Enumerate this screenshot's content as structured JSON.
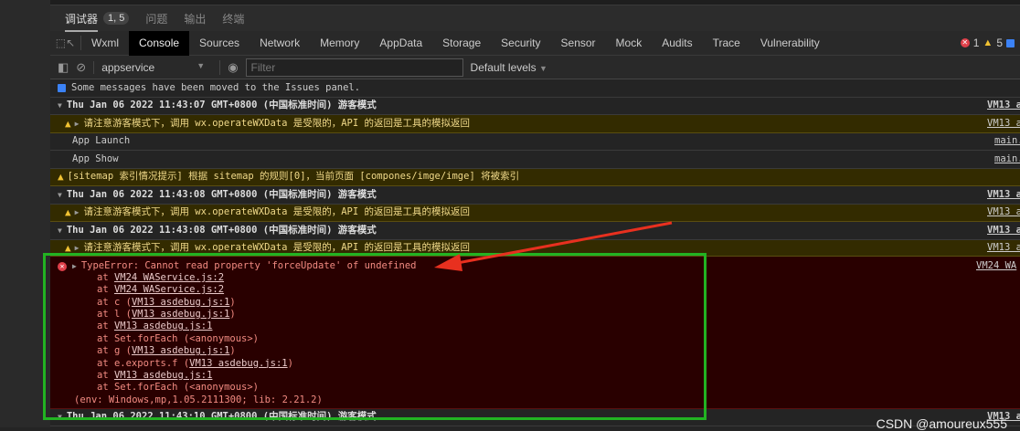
{
  "top_tabs": [
    {
      "label": "调试器",
      "badge": "1, 5"
    },
    {
      "label": "问题"
    },
    {
      "label": "输出"
    },
    {
      "label": "终端"
    }
  ],
  "dev_tabs": [
    "Wxml",
    "Console",
    "Sources",
    "Network",
    "Memory",
    "AppData",
    "Storage",
    "Security",
    "Sensor",
    "Mock",
    "Audits",
    "Trace",
    "Vulnerability"
  ],
  "counts": {
    "errors": "1",
    "warnings": "5"
  },
  "filterbar": {
    "context": "appservice",
    "filter_placeholder": "Filter",
    "levels": "Default levels"
  },
  "messages": {
    "issues": "Some messages have been moved to the Issues panel.",
    "group1": "Thu Jan 06 2022 11:43:07 GMT+0800 (中国标准时间) 游客模式",
    "warn_guest": "请注意游客模式下，调用 wx.operateWXData 是受限的，API 的返回是工具的模拟返回",
    "app_launch": "App Launch",
    "app_show": "App Show",
    "sitemap": "[sitemap 索引情况提示] 根据 sitemap 的规则[0]，当前页面 [compones/imge/imge] 将被索引",
    "group2": "Thu Jan 06 2022 11:43:08 GMT+0800 (中国标准时间) 游客模式",
    "group3": "Thu Jan 06 2022 11:43:08 GMT+0800 (中国标准时间) 游客模式",
    "group4": "Thu Jan 06 2022 11:43:10 GMT+0800 (中国标准时间) 游客模式",
    "src_vm13": "VM13 a",
    "src_main": "main.",
    "src_vm24": "VM24 WA"
  },
  "error": {
    "message": "TypeError: Cannot read property 'forceUpdate' of undefined",
    "stack": [
      {
        "pre": "at ",
        "link": "VM24 WAService.js:2",
        "post": ""
      },
      {
        "pre": "at ",
        "link": "VM24 WAService.js:2",
        "post": ""
      },
      {
        "pre": "at c (",
        "link": "VM13 asdebug.js:1",
        "post": ")"
      },
      {
        "pre": "at l (",
        "link": "VM13 asdebug.js:1",
        "post": ")"
      },
      {
        "pre": "at ",
        "link": "VM13 asdebug.js:1",
        "post": ""
      },
      {
        "pre": "at Set.forEach (<anonymous>)",
        "link": "",
        "post": ""
      },
      {
        "pre": "at g (",
        "link": "VM13 asdebug.js:1",
        "post": ")"
      },
      {
        "pre": "at e.exports.f (",
        "link": "VM13 asdebug.js:1",
        "post": ")"
      },
      {
        "pre": "at ",
        "link": "VM13 asdebug.js:1",
        "post": ""
      },
      {
        "pre": "at Set.forEach (<anonymous>)",
        "link": "",
        "post": ""
      }
    ],
    "env": "(env: Windows,mp,1.05.2111300; lib: 2.21.2)"
  },
  "watermark": "CSDN @amoureux555"
}
